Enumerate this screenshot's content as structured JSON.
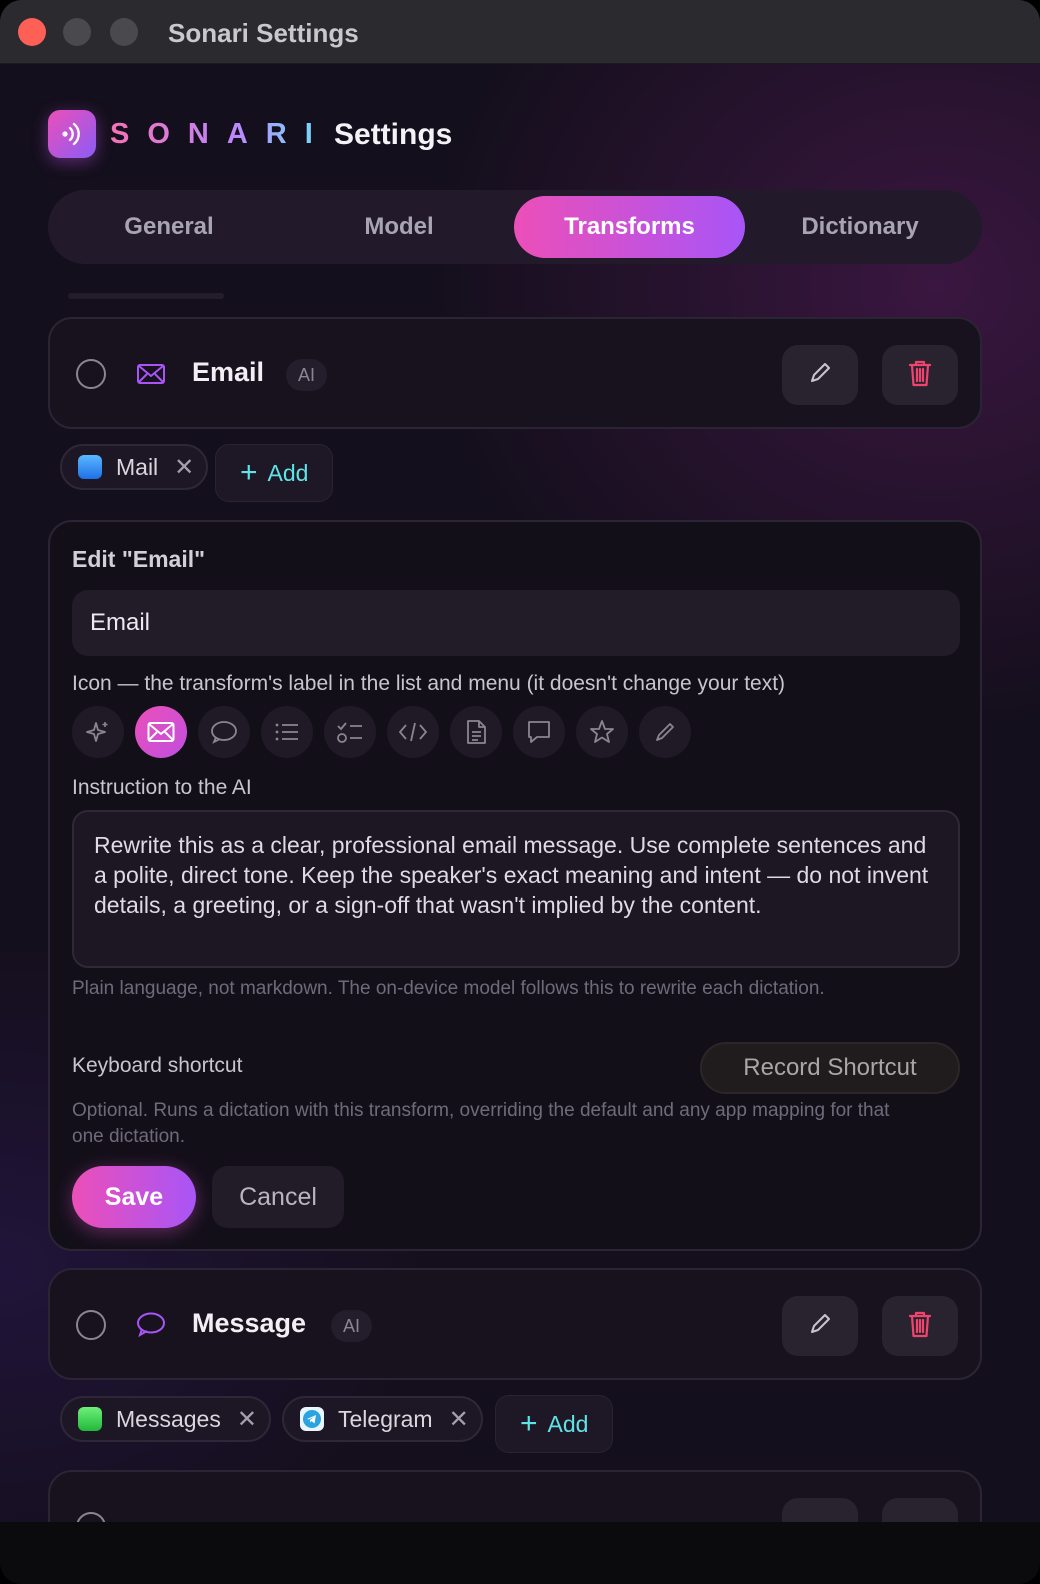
{
  "window": {
    "title": "Sonari Settings"
  },
  "header": {
    "brand": "SONARI",
    "title": "Settings"
  },
  "tabs": [
    {
      "label": "General",
      "active": false
    },
    {
      "label": "Model",
      "active": false
    },
    {
      "label": "Transforms",
      "active": true
    },
    {
      "label": "Dictionary",
      "active": false
    }
  ],
  "transforms": [
    {
      "name": "Email",
      "badge": "AI",
      "icon": "envelope-icon",
      "apps": [
        {
          "name": "Mail",
          "icon": "mail-app-icon"
        }
      ],
      "add_label": "Add"
    },
    {
      "name": "Message",
      "badge": "AI",
      "icon": "speech-bubble-icon",
      "apps": [
        {
          "name": "Messages",
          "icon": "messages-app-icon"
        },
        {
          "name": "Telegram",
          "icon": "telegram-app-icon"
        }
      ],
      "add_label": "Add"
    }
  ],
  "editor": {
    "title": "Edit \"Email\"",
    "name_value": "Email",
    "icon_label": "Icon — the transform's label in the list and menu (it doesn't change your text)",
    "icon_options": [
      "sparkles-icon",
      "envelope-icon",
      "speech-bubble-icon",
      "list-icon",
      "checklist-icon",
      "code-icon",
      "document-icon",
      "chat-icon",
      "star-icon",
      "pencil-icon"
    ],
    "selected_icon": "envelope-icon",
    "instruction_label": "Instruction to the AI",
    "instruction_value": "Rewrite this as a clear, professional email message. Use complete sentences and a polite, direct tone. Keep the speaker's exact meaning and intent — do not invent details, a greeting, or a sign-off that wasn't implied by the content.",
    "instruction_hint": "Plain language, not markdown. The on-device model follows this to rewrite each dictation.",
    "shortcut_label": "Keyboard shortcut",
    "record_label": "Record Shortcut",
    "shortcut_hint": "Optional. Runs a dictation with this transform, overriding the default and any app mapping for that one dictation.",
    "save_label": "Save",
    "cancel_label": "Cancel"
  },
  "colors": {
    "accent_pink": "#ec4fb8",
    "accent_purple": "#a855f7",
    "add_cyan": "#5ee3e6",
    "delete_red": "#f0436e"
  }
}
